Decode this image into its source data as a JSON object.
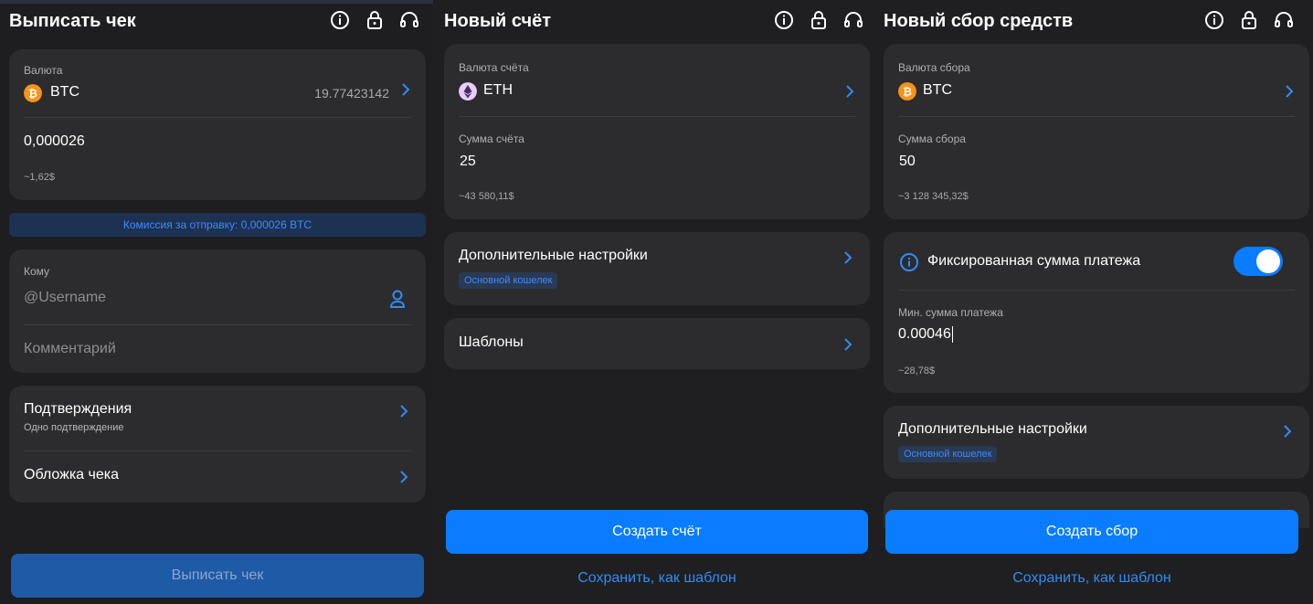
{
  "screen1": {
    "title": "Выписать чек",
    "currency_label": "Валюта",
    "currency_code": "BTC",
    "balance": "19.77423142",
    "amount": "0,000026",
    "amount_usd": "~1,62$",
    "fee_banner": "Комиссия за отправку: 0,000026 BTC",
    "to_label": "Кому",
    "username_placeholder": "@Username",
    "comment_placeholder": "Комментарий",
    "confirmations_title": "Подтверждения",
    "confirmations_value": "Одно подтверждение",
    "cover_title": "Обложка чека",
    "submit_label": "Выписать чек"
  },
  "screen2": {
    "title": "Новый счёт",
    "currency_label": "Валюта счёта",
    "currency_code": "ETH",
    "amount_label": "Сумма счёта",
    "amount": "25",
    "amount_usd": "~43 580,11$",
    "advanced_title": "Дополнительные настройки",
    "advanced_tag": "Основной кошелек",
    "templates_title": "Шаблоны",
    "submit_label": "Создать счёт",
    "save_template_label": "Сохранить, как шаблон"
  },
  "screen3": {
    "title": "Новый сбор средств",
    "currency_label": "Валюта сбора",
    "currency_code": "BTC",
    "amount_label": "Сумма сбора",
    "amount": "50",
    "amount_usd": "~3 128 345,32$",
    "fixed_label": "Фиксированная сумма платежа",
    "fixed_enabled": true,
    "min_label": "Мин. сумма платежа",
    "min_value": "0.00046",
    "min_usd": "~28,78$",
    "advanced_title": "Дополнительные настройки",
    "advanced_tag": "Основной кошелек",
    "submit_label": "Создать сбор",
    "save_template_label": "Сохранить, как шаблон"
  },
  "icons": {
    "info": "info-icon",
    "lock": "lock-icon",
    "support": "headset-icon",
    "chevron": "chevron-right-icon",
    "user": "user-icon",
    "btc": "bitcoin-icon",
    "eth": "ethereum-icon"
  },
  "colors": {
    "accent": "#0a7cff",
    "accent_disabled": "#1f5aa6",
    "card": "#2c2c2e",
    "background": "#1c1c1e",
    "link": "#2f8cf5",
    "btc": "#f7931a",
    "eth": "#d9b8f5"
  }
}
